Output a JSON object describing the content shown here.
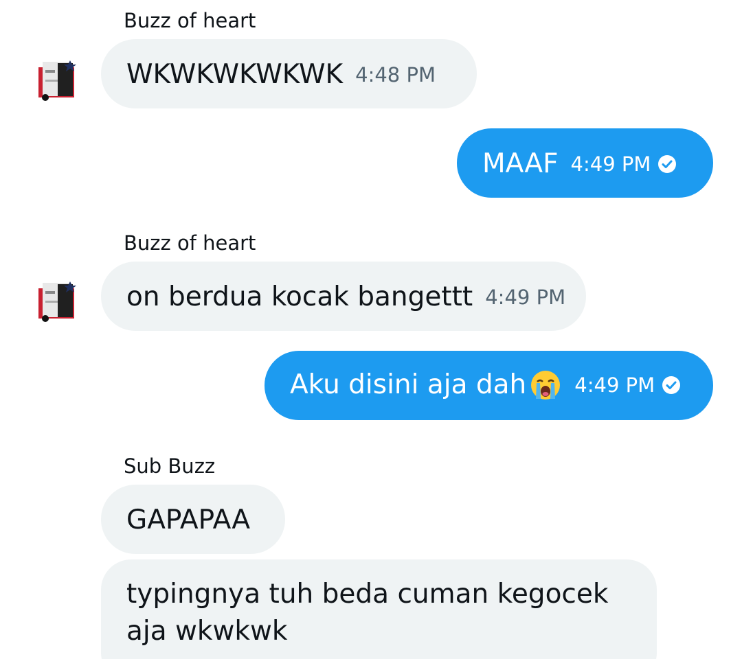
{
  "messages": [
    {
      "sender": "Buzz of heart",
      "text": "WKWKWKWKWK",
      "time": "4:48 PM"
    },
    {
      "text": "MAAF",
      "time": "4:49 PM"
    },
    {
      "sender": "Buzz of heart",
      "text": "on berdua kocak bangettt",
      "time": "4:49 PM"
    },
    {
      "text": "Aku disini aja dah",
      "emoji": "loudly-crying-face-emoji",
      "time": "4:49 PM"
    },
    {
      "sender": "Sub Buzz",
      "text": "GAPAPAA"
    },
    {
      "text_line1": "typingnya tuh beda cuman kegocek",
      "text_line2": "aja wkwkwk"
    }
  ],
  "colors": {
    "incoming_bubble": "#eff3f4",
    "outgoing_bubble": "#1d9bf0",
    "timestamp_incoming": "#536471"
  },
  "icons": {
    "sent_status": "check-circle-icon",
    "avatar": "avatar"
  }
}
